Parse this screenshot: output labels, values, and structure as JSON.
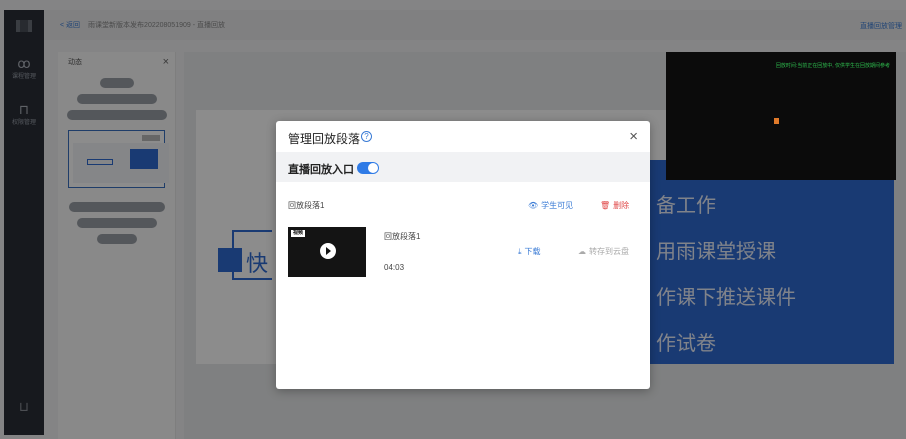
{
  "topbar": {
    "back_label": "< 返回",
    "breadcrumb": "雨课堂新版本发布202208051909 - 直播回放",
    "right_link": "直播回放管理"
  },
  "leftnav": {
    "items": [
      {
        "icon": "people-icon",
        "label": "课程管理"
      },
      {
        "icon": "lock-icon",
        "label": "权限管理"
      }
    ],
    "bottom_icon": "export-icon"
  },
  "slides_panel": {
    "header": "动态"
  },
  "slide": {
    "lines": [
      "备工作",
      "用雨课堂授课",
      "作课下推送课件",
      "作试卷"
    ],
    "left_char": "快"
  },
  "video_preview": {
    "note": "回放时间:当前正在回放中, 仅供学生在回放期间参考"
  },
  "modal": {
    "title": "管理回放段落",
    "help_icon": "?",
    "close_icon": "×",
    "entry_label": "直播回放入口",
    "entry_enabled": true,
    "segment": {
      "header": "回放段落1",
      "visible_label": "学生可见",
      "delete_label": "删除",
      "name": "回放段落1",
      "duration": "04:03",
      "tag": "视频",
      "download_label": "下载",
      "cloud_label": "转存到云盘"
    }
  },
  "colors": {
    "accent": "#2f7be6",
    "danger": "#e04848",
    "nav_bg": "#2b2f38",
    "slide_blue": "#2f6bd1"
  }
}
